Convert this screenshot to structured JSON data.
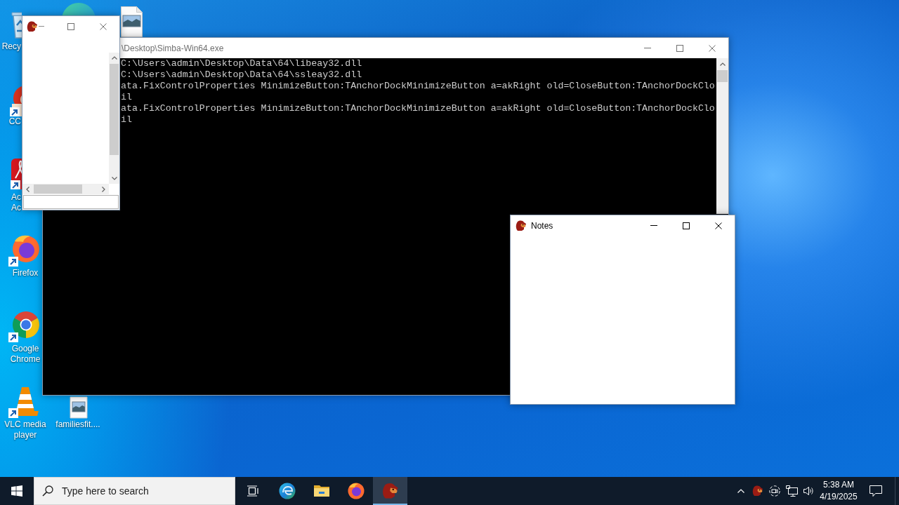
{
  "desktop_icons": [
    {
      "label": "Recy"
    },
    {
      "label": "CC"
    },
    {
      "label": "Ac Ac"
    },
    {
      "label": "Firefox"
    },
    {
      "label": "Google Chrome"
    },
    {
      "label": "VLC media player"
    },
    {
      "label": "familiesfit...."
    }
  ],
  "console_window": {
    "title": "\\Desktop\\Simba-Win64.exe",
    "lines": [
      "C:\\Users\\admin\\Desktop\\Data\\64\\libeay32.dll",
      "C:\\Users\\admin\\Desktop\\Data\\64\\ssleay32.dll",
      "ata.FixControlProperties MinimizeButton:TAnchorDockMinimizeButton a=akRight old=CloseButton:TAnchorDockClo",
      "il",
      "ata.FixControlProperties MinimizeButton:TAnchorDockMinimizeButton a=akRight old=CloseButton:TAnchorDockClo",
      "il"
    ]
  },
  "notes_window": {
    "title": "Notes"
  },
  "taskbar": {
    "search": {
      "placeholder": "Type here to search"
    },
    "apps": [
      {
        "selected": false
      },
      {
        "selected": false
      },
      {
        "selected": false
      },
      {
        "selected": false
      },
      {
        "selected": true
      }
    ],
    "clock": {
      "time": "5:38 AM",
      "date": "4/19/2025"
    }
  }
}
